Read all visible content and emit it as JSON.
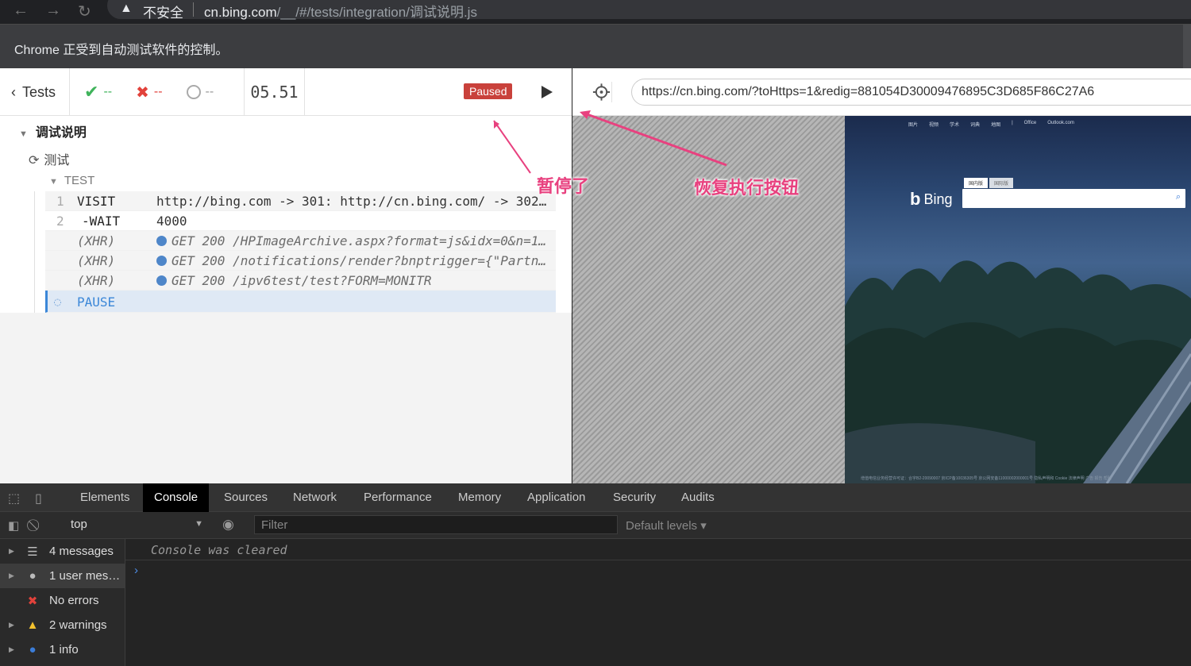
{
  "browser": {
    "back_icon": "←",
    "forward_icon": "→",
    "reload_icon": "↻",
    "security_label": "不安全",
    "url_host": "cn.bing.com",
    "url_path": "/__/#/tests/integration/调试说明.js",
    "automation_notice": "Chrome 正受到自动测试软件的控制。"
  },
  "runner": {
    "tests_label": "Tests",
    "passed": "--",
    "failed": "--",
    "pending": "--",
    "timer": "05.51",
    "paused_badge": "Paused"
  },
  "reporter": {
    "suite_title": "调试说明",
    "test_title": "测试",
    "group_title": "TEST",
    "commands": [
      {
        "num": "1",
        "name": "VISIT",
        "message": "http://bing.com -> 301: http://cn.bing.com/ -> 302: …"
      },
      {
        "num": "2",
        "name": "-WAIT",
        "message": "4000"
      },
      {
        "num": "",
        "name": "(XHR)",
        "message": "GET 200 /HPImageArchive.aspx?format=js&idx=0&n=1&n…"
      },
      {
        "num": "",
        "name": "(XHR)",
        "message": "GET 200 /notifications/render?bnptrigger={\"Partner…"
      },
      {
        "num": "",
        "name": "(XHR)",
        "message": "GET 200 /ipv6test/test?FORM=MONITR"
      },
      {
        "num": "",
        "name": "PAUSE",
        "message": ""
      }
    ]
  },
  "annotations": {
    "paused": "暂停了",
    "resume": "恢复执行按钮"
  },
  "aut": {
    "url": "https://cn.bing.com/?toHttps=1&redig=881054D30009476895C3D685F86C27A6",
    "bing_nav": [
      "图片",
      "视频",
      "学术",
      "词典",
      "地图",
      "|",
      "Office",
      "Outlook.com"
    ],
    "bing_logo": "Bing",
    "bing_tab_cn": "国内版",
    "bing_tab_intl": "国际版",
    "bing_footer": "增值电信业务经营许可证：合字B2-20090007   京ICP备10036305号   京公网安备11000002000001号   隐私声明和 Cookie   法律声明   广告   报告   帮助"
  },
  "devtools": {
    "tabs": [
      "Elements",
      "Console",
      "Sources",
      "Network",
      "Performance",
      "Memory",
      "Application",
      "Security",
      "Audits"
    ],
    "active_tab": "Console",
    "context": "top",
    "filter_placeholder": "Filter",
    "levels": "Default levels ▾",
    "sidebar": [
      {
        "label": "4 messages",
        "icon": "list-icon"
      },
      {
        "label": "1 user mes…",
        "icon": "user-icon"
      },
      {
        "label": "No errors",
        "icon": "error-icon"
      },
      {
        "label": "2 warnings",
        "icon": "warning-icon"
      },
      {
        "label": "1 info",
        "icon": "info-icon"
      }
    ],
    "cleared_message": "Console was cleared",
    "prompt": "›"
  }
}
